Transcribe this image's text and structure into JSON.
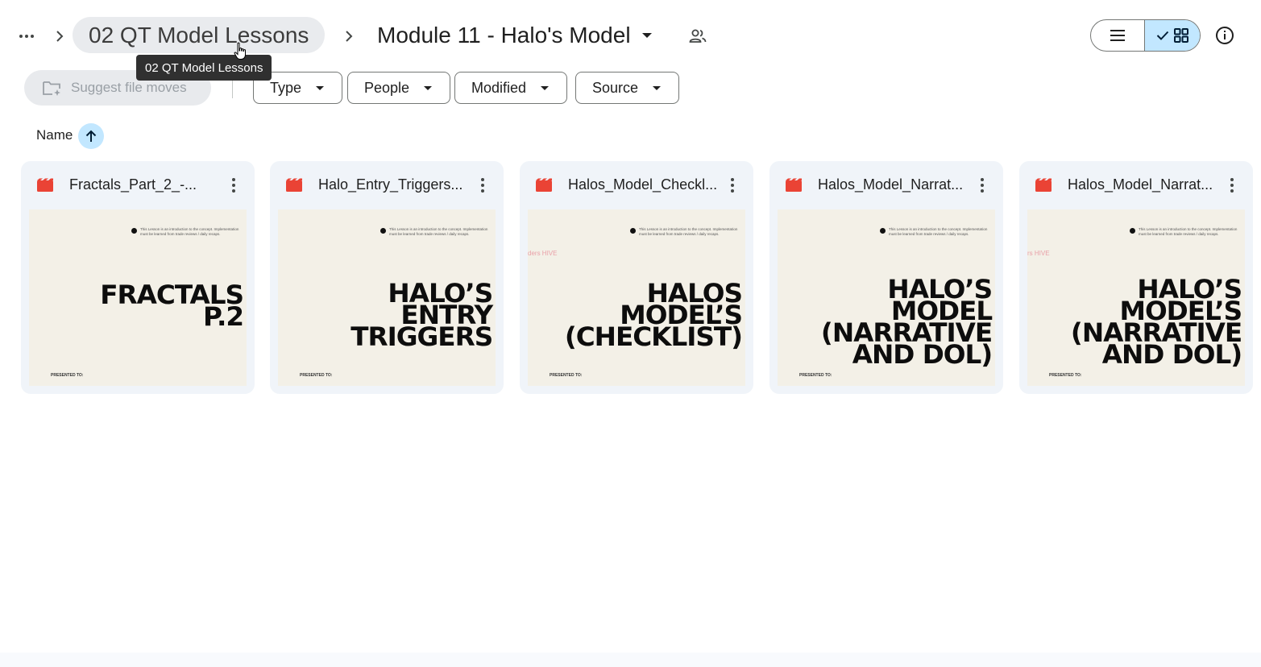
{
  "breadcrumb": {
    "parent_label": "02 QT Model Lessons",
    "current_label": "Module 11 - Halo's Model",
    "tooltip": "02 QT Model Lessons"
  },
  "icons": {
    "more": "more-horizontal-icon",
    "separator": "chevron-right-icon",
    "shared": "people-icon",
    "list_view": "list-icon",
    "grid_view": "grid-icon",
    "checked": "check-icon",
    "info": "info-icon",
    "suggest": "folder-sparkle-icon",
    "sort": "arrow-up-icon",
    "file_type": "video-icon",
    "kebab": "more-vertical-icon"
  },
  "filters": {
    "suggest_label": "Suggest file moves",
    "chips": [
      {
        "label": "Type"
      },
      {
        "label": "People"
      },
      {
        "label": "Modified"
      },
      {
        "label": "Source"
      }
    ]
  },
  "sort": {
    "label": "Name",
    "direction": "ascending"
  },
  "colors": {
    "accent_selected": "#c2e7ff",
    "card_bg": "#f0f4f9",
    "video_icon": "#ea4335",
    "thumb_bg": "#f3f0e7"
  },
  "files": [
    {
      "title": "Fractals_Part_2_-...",
      "thumb_title": "FRACTALS\nP.2",
      "thumb_note": "This Lesson is an introduction to the concept. Implementation must be learned from trade reviews / daily recaps.",
      "thumb_mark": "",
      "thumb_footer": "PRESENTED TO:"
    },
    {
      "title": "Halo_Entry_Triggers...",
      "thumb_title": "HALO’S\nENTRY\nTRIGGERS",
      "thumb_note": "This Lesson is an introduction to the concept. Implementation must be learned from trade reviews / daily recaps.",
      "thumb_mark": "",
      "thumb_footer": "PRESENTED TO:"
    },
    {
      "title": "Halos_Model_Checkl...",
      "thumb_title": "HALOS\nMODEL’S\n(CHECKLIST)",
      "thumb_note": "This Lesson is an introduction to the concept. Implementation must be learned from trade reviews / daily recaps.",
      "thumb_mark": "ders HIVE",
      "thumb_footer": "PRESENTED TO:"
    },
    {
      "title": "Halos_Model_Narrat...",
      "thumb_title": "HALO’S\nMODEL\n(NARRATIVE\nAND DOL)",
      "thumb_note": "This Lesson is an introduction to the concept. Implementation must be learned from trade reviews / daily recaps.",
      "thumb_mark": "",
      "thumb_footer": "PRESENTED TO:"
    },
    {
      "title": "Halos_Model_Narrat...",
      "thumb_title": "HALO’S\nMODEL’S\n(NARRATIVE\nAND DOL)",
      "thumb_note": "This Lesson is an introduction to the concept. Implementation must be learned from trade reviews / daily recaps.",
      "thumb_mark": "rs HIVE",
      "thumb_footer": "PRESENTED TO:"
    }
  ]
}
